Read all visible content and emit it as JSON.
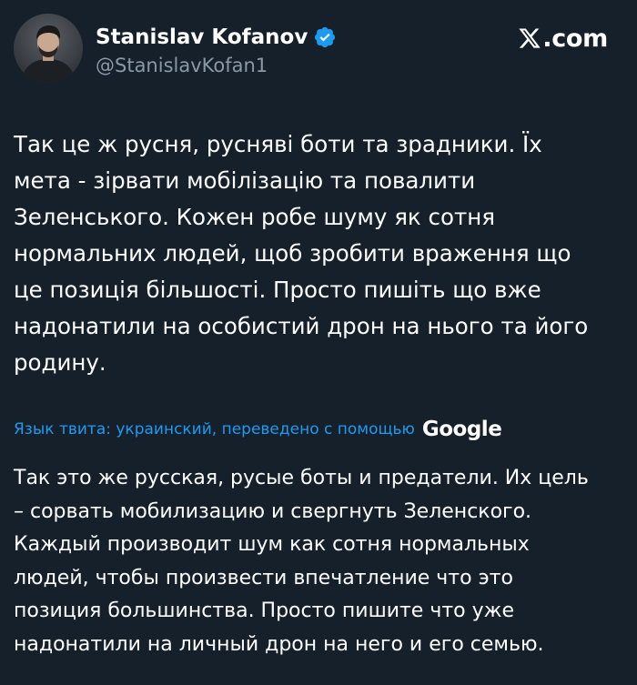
{
  "author": {
    "display_name": "Stanislav Kofanov",
    "handle": "@StanislavKofan1",
    "verified": true,
    "avatar_alt": "avatar"
  },
  "brand": {
    "text": ".com",
    "icon": "x-logo-icon"
  },
  "tweet": {
    "text": "Так це ж русня, руснявi боти та зрадники. Їх\nмета - зiрвати мобiлiзацiю та повалити\nЗеленського. Кожен робе шуму як сотня\nнормальних людей, щоб зробити враження що\nце позицiя бiльшостi. Просто пишiть що вже\nнадонатили на особистий дрон  на нього та його\nродину."
  },
  "translation": {
    "label": "Язык твита: украинский, переведено с помощью",
    "provider": "Google",
    "text": "Так это же русская, русые боты и предатели. Их цель\n– сорвать мобилизацию и свергнуть Зеленского.\nКаждый производит шум как сотня нормальных\nлюдей, чтобы произвести впечатление что это\nпозиция большинства. Просто пишите что уже\nнадонатили на личный дрон на него и его семью."
  },
  "colors": {
    "background": "#15202b",
    "text": "#ffffff",
    "secondary_text": "#8b98a5",
    "link": "#1d9bf0",
    "verified_badge": "#1d9bf0"
  }
}
